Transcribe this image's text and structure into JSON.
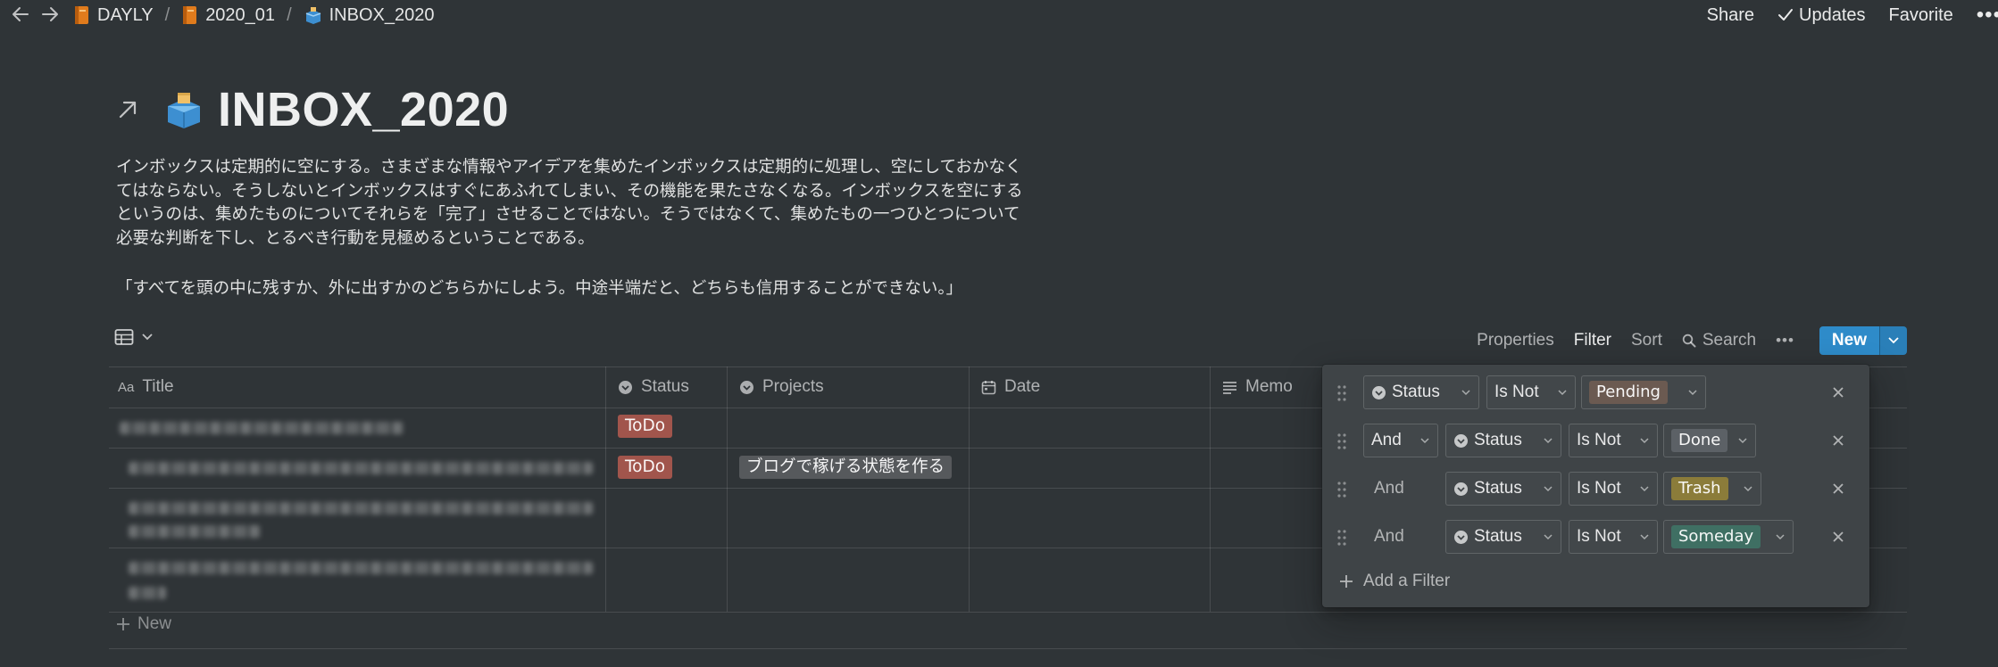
{
  "topbar": {
    "breadcrumbs": [
      {
        "label": "DAYLY"
      },
      {
        "label": "2020_01"
      },
      {
        "label": "INBOX_2020"
      }
    ],
    "separator": "/",
    "share": "Share",
    "updates": "Updates",
    "favorite": "Favorite",
    "more": "•••"
  },
  "page": {
    "title": "INBOX_2020",
    "description_lines": [
      "インボックスは定期的に空にする。さまざまな情報やアイデアを集めたインボックスは定期的に処理し、空にしておかなく",
      "てはならない。そうしないとインボックスはすぐにあふれてしまい、その機能を果たさなくなる。インボックスを空にする",
      "というのは、集めたものについてそれらを「完了」させることではない。そうではなくて、集めたもの一つひとつについて",
      "必要な判断を下し、とるべき行動を見極めるということである。"
    ],
    "quote": "「すべてを頭の中に残すか、外に出すかのどちらかにしよう。中途半端だと、どちらも信用することができない。」"
  },
  "toolbar": {
    "properties": "Properties",
    "filter": "Filter",
    "sort": "Sort",
    "search": "Search",
    "more": "•••",
    "new": "New"
  },
  "table": {
    "columns": {
      "title": "Title",
      "status": "Status",
      "projects": "Projects",
      "date": "Date",
      "memo": "Memo"
    },
    "title_prefix": "Aa",
    "rows": [
      {
        "status": "ToDo",
        "project": ""
      },
      {
        "status": "ToDo",
        "project": "ブログで稼げる状態を作る"
      },
      {
        "status": "",
        "project": ""
      },
      {
        "status": "",
        "project": ""
      }
    ],
    "new_row": "New"
  },
  "filter_popup": {
    "filters": [
      {
        "conj": "",
        "prop": "Status",
        "op": "Is Not",
        "value": "Pending",
        "value_color": "#6b5a51"
      },
      {
        "conj": "And",
        "prop": "Status",
        "op": "Is Not",
        "value": "Done",
        "value_color": "#5c6166"
      },
      {
        "conj": "And",
        "prop": "Status",
        "op": "Is Not",
        "value": "Trash",
        "value_color": "#8b7c3a"
      },
      {
        "conj": "And",
        "prop": "Status",
        "op": "Is Not",
        "value": "Someday",
        "value_color": "#3f6f63"
      }
    ],
    "add_filter": "Add a Filter"
  },
  "colors": {
    "todo_tag": "#a1554c",
    "project_tag": "#56595c",
    "accent_blue": "#2e8bc9"
  }
}
